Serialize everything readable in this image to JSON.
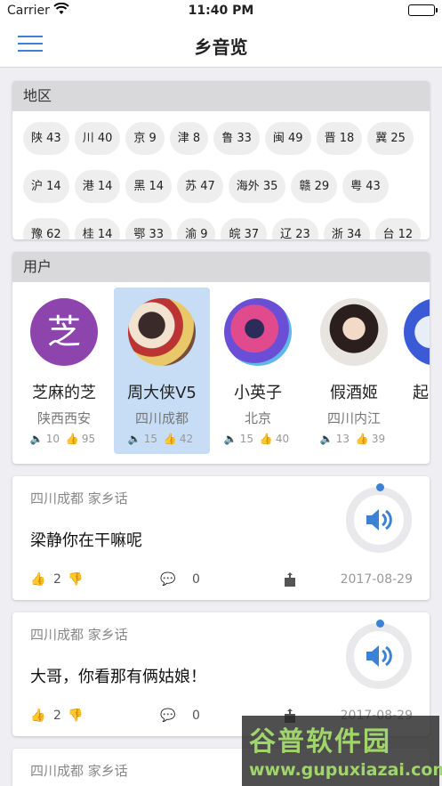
{
  "status_bar": {
    "carrier": "Carrier",
    "time": "11:40 PM"
  },
  "nav": {
    "title": "乡音览",
    "menu_icon": "hamburger-menu-icon"
  },
  "regions": {
    "header": "地区",
    "rows": [
      [
        "陕 43",
        "川 40",
        "京 9",
        "津 8",
        "鲁 33",
        "闽 49",
        "晋 18",
        "冀 25"
      ],
      [
        "沪 14",
        "港 14",
        "黑 14",
        "苏 47",
        "海外 35",
        "赣 29",
        "粤 43"
      ],
      [
        "豫 62",
        "桂 14",
        "鄂 33",
        "渝 9",
        "皖 37",
        "辽 23",
        "浙 34",
        "台 12"
      ]
    ]
  },
  "users": {
    "header": "用户",
    "items": [
      {
        "name": "芝麻的芝",
        "location": "陕西西安",
        "plays": "10",
        "likes": "95",
        "avatar_char": "芝",
        "selected": false
      },
      {
        "name": "周大侠V5",
        "location": "四川成都",
        "plays": "15",
        "likes": "42",
        "selected": true
      },
      {
        "name": "小英子",
        "location": "北京",
        "plays": "15",
        "likes": "40",
        "selected": false
      },
      {
        "name": "假酒姬",
        "location": "四川内江",
        "plays": "13",
        "likes": "39",
        "selected": false
      },
      {
        "name": "起",
        "location": "",
        "plays": "",
        "likes": "",
        "selected": false
      }
    ]
  },
  "posts": [
    {
      "location": "四川成都 家乡话",
      "text": "梁静你在干嘛呢",
      "likes": "2",
      "comments": "0",
      "date": "2017-08-29"
    },
    {
      "location": "四川成都 家乡话",
      "text": "大哥，你看那有俩姑娘！",
      "likes": "2",
      "comments": "0",
      "date": "2017-08-29"
    },
    {
      "location": "四川成都 家乡话"
    }
  ],
  "watermark": {
    "big": "谷普软件园",
    "small": "www.gupuxiazai.com"
  },
  "colors": {
    "accent": "#3b82d6",
    "selected_bg": "#c7ddf5",
    "header_bg": "#d9d9dc"
  }
}
